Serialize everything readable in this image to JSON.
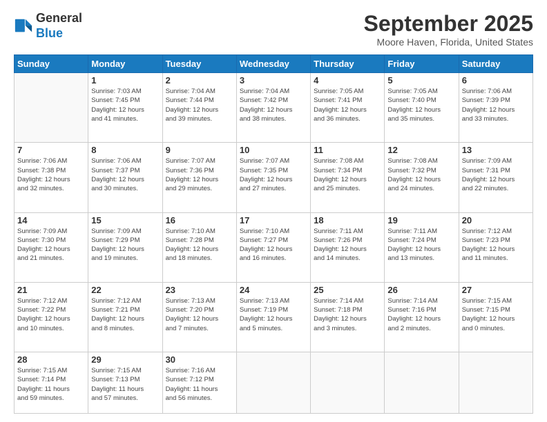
{
  "logo": {
    "line1": "General",
    "line2": "Blue"
  },
  "title": "September 2025",
  "location": "Moore Haven, Florida, United States",
  "weekdays": [
    "Sunday",
    "Monday",
    "Tuesday",
    "Wednesday",
    "Thursday",
    "Friday",
    "Saturday"
  ],
  "weeks": [
    [
      {
        "day": "",
        "info": ""
      },
      {
        "day": "1",
        "info": "Sunrise: 7:03 AM\nSunset: 7:45 PM\nDaylight: 12 hours\nand 41 minutes."
      },
      {
        "day": "2",
        "info": "Sunrise: 7:04 AM\nSunset: 7:44 PM\nDaylight: 12 hours\nand 39 minutes."
      },
      {
        "day": "3",
        "info": "Sunrise: 7:04 AM\nSunset: 7:42 PM\nDaylight: 12 hours\nand 38 minutes."
      },
      {
        "day": "4",
        "info": "Sunrise: 7:05 AM\nSunset: 7:41 PM\nDaylight: 12 hours\nand 36 minutes."
      },
      {
        "day": "5",
        "info": "Sunrise: 7:05 AM\nSunset: 7:40 PM\nDaylight: 12 hours\nand 35 minutes."
      },
      {
        "day": "6",
        "info": "Sunrise: 7:06 AM\nSunset: 7:39 PM\nDaylight: 12 hours\nand 33 minutes."
      }
    ],
    [
      {
        "day": "7",
        "info": "Sunrise: 7:06 AM\nSunset: 7:38 PM\nDaylight: 12 hours\nand 32 minutes."
      },
      {
        "day": "8",
        "info": "Sunrise: 7:06 AM\nSunset: 7:37 PM\nDaylight: 12 hours\nand 30 minutes."
      },
      {
        "day": "9",
        "info": "Sunrise: 7:07 AM\nSunset: 7:36 PM\nDaylight: 12 hours\nand 29 minutes."
      },
      {
        "day": "10",
        "info": "Sunrise: 7:07 AM\nSunset: 7:35 PM\nDaylight: 12 hours\nand 27 minutes."
      },
      {
        "day": "11",
        "info": "Sunrise: 7:08 AM\nSunset: 7:34 PM\nDaylight: 12 hours\nand 25 minutes."
      },
      {
        "day": "12",
        "info": "Sunrise: 7:08 AM\nSunset: 7:32 PM\nDaylight: 12 hours\nand 24 minutes."
      },
      {
        "day": "13",
        "info": "Sunrise: 7:09 AM\nSunset: 7:31 PM\nDaylight: 12 hours\nand 22 minutes."
      }
    ],
    [
      {
        "day": "14",
        "info": "Sunrise: 7:09 AM\nSunset: 7:30 PM\nDaylight: 12 hours\nand 21 minutes."
      },
      {
        "day": "15",
        "info": "Sunrise: 7:09 AM\nSunset: 7:29 PM\nDaylight: 12 hours\nand 19 minutes."
      },
      {
        "day": "16",
        "info": "Sunrise: 7:10 AM\nSunset: 7:28 PM\nDaylight: 12 hours\nand 18 minutes."
      },
      {
        "day": "17",
        "info": "Sunrise: 7:10 AM\nSunset: 7:27 PM\nDaylight: 12 hours\nand 16 minutes."
      },
      {
        "day": "18",
        "info": "Sunrise: 7:11 AM\nSunset: 7:26 PM\nDaylight: 12 hours\nand 14 minutes."
      },
      {
        "day": "19",
        "info": "Sunrise: 7:11 AM\nSunset: 7:24 PM\nDaylight: 12 hours\nand 13 minutes."
      },
      {
        "day": "20",
        "info": "Sunrise: 7:12 AM\nSunset: 7:23 PM\nDaylight: 12 hours\nand 11 minutes."
      }
    ],
    [
      {
        "day": "21",
        "info": "Sunrise: 7:12 AM\nSunset: 7:22 PM\nDaylight: 12 hours\nand 10 minutes."
      },
      {
        "day": "22",
        "info": "Sunrise: 7:12 AM\nSunset: 7:21 PM\nDaylight: 12 hours\nand 8 minutes."
      },
      {
        "day": "23",
        "info": "Sunrise: 7:13 AM\nSunset: 7:20 PM\nDaylight: 12 hours\nand 7 minutes."
      },
      {
        "day": "24",
        "info": "Sunrise: 7:13 AM\nSunset: 7:19 PM\nDaylight: 12 hours\nand 5 minutes."
      },
      {
        "day": "25",
        "info": "Sunrise: 7:14 AM\nSunset: 7:18 PM\nDaylight: 12 hours\nand 3 minutes."
      },
      {
        "day": "26",
        "info": "Sunrise: 7:14 AM\nSunset: 7:16 PM\nDaylight: 12 hours\nand 2 minutes."
      },
      {
        "day": "27",
        "info": "Sunrise: 7:15 AM\nSunset: 7:15 PM\nDaylight: 12 hours\nand 0 minutes."
      }
    ],
    [
      {
        "day": "28",
        "info": "Sunrise: 7:15 AM\nSunset: 7:14 PM\nDaylight: 11 hours\nand 59 minutes."
      },
      {
        "day": "29",
        "info": "Sunrise: 7:15 AM\nSunset: 7:13 PM\nDaylight: 11 hours\nand 57 minutes."
      },
      {
        "day": "30",
        "info": "Sunrise: 7:16 AM\nSunset: 7:12 PM\nDaylight: 11 hours\nand 56 minutes."
      },
      {
        "day": "",
        "info": ""
      },
      {
        "day": "",
        "info": ""
      },
      {
        "day": "",
        "info": ""
      },
      {
        "day": "",
        "info": ""
      }
    ]
  ]
}
